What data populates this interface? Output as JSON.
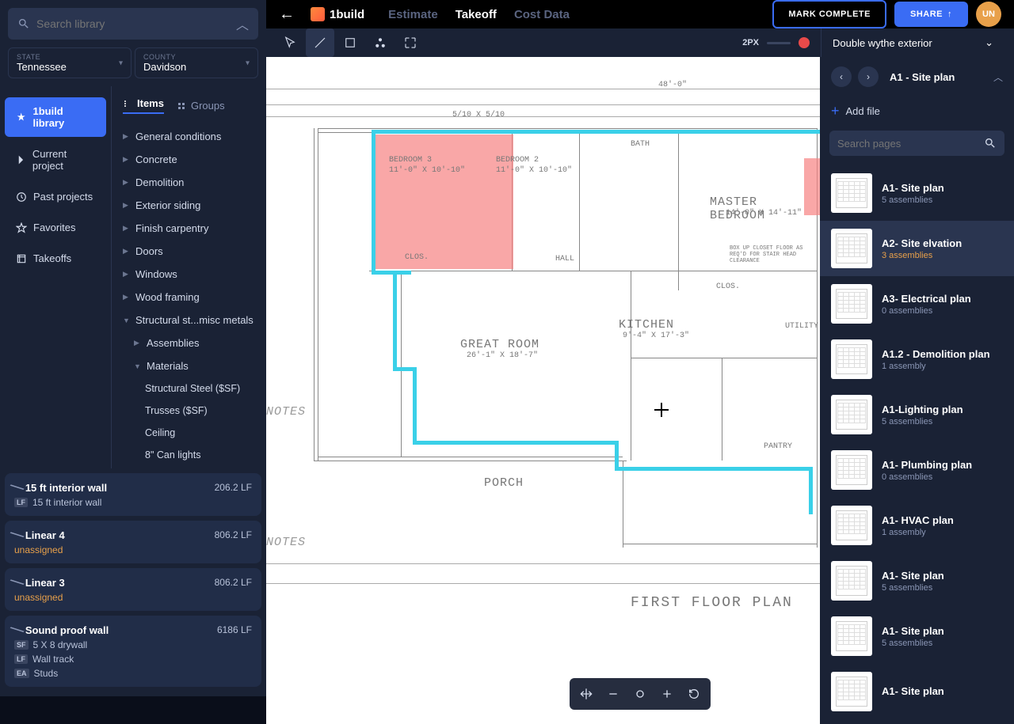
{
  "search": {
    "placeholder": "Search library"
  },
  "location": {
    "state": {
      "label": "STATE",
      "value": "Tennessee"
    },
    "county": {
      "label": "COUNTY",
      "value": "Davidson"
    }
  },
  "nav": {
    "library": "1build library",
    "current": "Current project",
    "past": "Past projects",
    "favorites": "Favorites",
    "takeoffs": "Takeoffs"
  },
  "tree_tabs": {
    "items": "Items",
    "groups": "Groups"
  },
  "tree": {
    "general": "General conditions",
    "concrete": "Concrete",
    "demolition": "Demolition",
    "exterior": "Exterior siding",
    "finish": "Finish carpentry",
    "doors": "Doors",
    "windows": "Windows",
    "wood": "Wood framing",
    "structural": "Structural st...misc metals",
    "assemblies": "Assemblies",
    "materials": "Materials",
    "steel": "Structural Steel ($SF)",
    "trusses": "Trusses ($SF)",
    "ceiling": "Ceiling",
    "canlights": "8\" Can lights"
  },
  "measurements": [
    {
      "title": "15 ft interior wall",
      "value": "206.2 LF",
      "subs": [
        {
          "badge": "LF",
          "text": "15 ft interior wall"
        }
      ]
    },
    {
      "title": "Linear 4",
      "value": "806.2 LF",
      "subs": [
        {
          "text": "unassigned",
          "unassigned": true
        }
      ]
    },
    {
      "title": "Linear 3",
      "value": "806.2 LF",
      "subs": [
        {
          "text": "unassigned",
          "unassigned": true
        }
      ]
    },
    {
      "title": "Sound proof wall",
      "value": "6186 LF",
      "subs": [
        {
          "badge": "SF",
          "text": "5 X 8 drywall"
        },
        {
          "badge": "LF",
          "text": "Wall track"
        },
        {
          "badge": "EA",
          "text": "Studs"
        }
      ]
    }
  ],
  "topbar": {
    "brand": "1build",
    "tabs": {
      "estimate": "Estimate",
      "takeoff": "Takeoff",
      "costdata": "Cost Data"
    },
    "complete": "MARK COMPLETE",
    "share": "SHARE",
    "avatar": "UN"
  },
  "toolbar": {
    "px": "2PX",
    "layer": "Double wythe exterior"
  },
  "blueprint": {
    "bedroom3": "BEDROOM 3",
    "bedroom3dim": "11'-0\" X 10'-10\"",
    "bedroom2": "BEDROOM 2",
    "bedroom2dim": "11'-0\" X 10'-10\"",
    "bath": "BATH",
    "master": "MASTER BEDROOM",
    "masterdim": "14'-0\" X 14'-11\"",
    "hall": "HALL",
    "great": "GREAT ROOM",
    "greatdim": "26'-1\" X 18'-7\"",
    "kitchen": "KITCHEN",
    "kitchendim": "9'-4\" X 17'-3\"",
    "utility": "UTILITY",
    "pantry": "PANTRY",
    "porch": "PORCH",
    "title": "FIRST FLOOR PLAN",
    "notes": "NOTES",
    "clos": "CLOS.",
    "boxnote": "BOX UP CLOSET FLOOR AS REQ'D FOR STAIR HEAD CLEARANCE"
  },
  "right": {
    "title": "A1 - Site plan",
    "addfile": "Add file",
    "search_ph": "Search pages",
    "pages": [
      {
        "name": "A1- Site plan",
        "sub": "5 assemblies"
      },
      {
        "name": "A2- Site elvation",
        "sub": "3 assemblies",
        "selected": true
      },
      {
        "name": "A3- Electrical plan",
        "sub": "0 assemblies"
      },
      {
        "name": "A1.2 - Demolition plan",
        "sub": "1 assembly"
      },
      {
        "name": "A1-Lighting plan",
        "sub": "5 assemblies"
      },
      {
        "name": "A1- Plumbing plan",
        "sub": "0 assemblies"
      },
      {
        "name": "A1- HVAC plan",
        "sub": "1 assembly"
      },
      {
        "name": "A1- Site plan",
        "sub": "5 assemblies"
      },
      {
        "name": "A1- Site plan",
        "sub": "5 assemblies"
      },
      {
        "name": "A1- Site plan",
        "sub": ""
      }
    ]
  }
}
